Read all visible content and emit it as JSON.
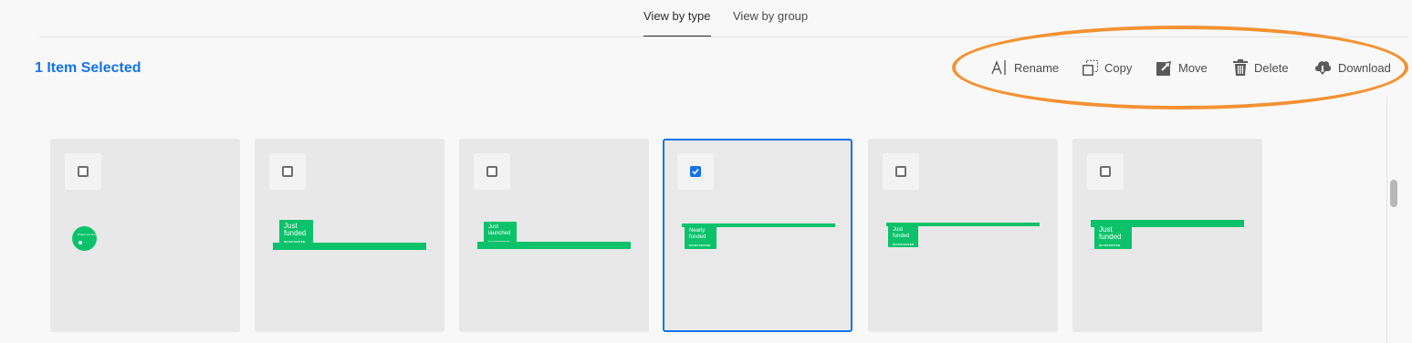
{
  "tabs": [
    {
      "label": "View by type",
      "active": true
    },
    {
      "label": "View by group",
      "active": false
    }
  ],
  "selection": {
    "count_label": "1 Item Selected"
  },
  "actions": {
    "rename": "Rename",
    "copy": "Copy",
    "move": "Move",
    "delete": "Delete",
    "download": "Download"
  },
  "assets": [
    {
      "type": "circle-sticker",
      "checked": false,
      "badge_text": "Project we love"
    },
    {
      "type": "banner",
      "checked": false,
      "badge_text": "Just\nfunded",
      "brand": "KICKSTARTER"
    },
    {
      "type": "banner",
      "checked": false,
      "badge_text": "Just\nlaunched",
      "brand": "KICKSTARTER"
    },
    {
      "type": "banner",
      "checked": true,
      "badge_text": "Nearly\nfunded",
      "brand": "KICKSTARTER"
    },
    {
      "type": "banner",
      "checked": false,
      "badge_text": "Just\nfunded",
      "brand": "KICKSTARTER"
    },
    {
      "type": "banner",
      "checked": false,
      "badge_text": "Just\nfunded",
      "brand": "KICKSTARTER"
    }
  ],
  "colors": {
    "accent": "#1473e6",
    "brand_green": "#0bc26a",
    "annotation": "#f39233",
    "card_bg": "#e8e8e8"
  },
  "icons": {
    "rename": "text-cursor-icon",
    "copy": "copy-icon",
    "move": "move-icon",
    "delete": "trash-icon",
    "download": "cloud-download-icon",
    "checkbox": "checkbox-icon"
  }
}
